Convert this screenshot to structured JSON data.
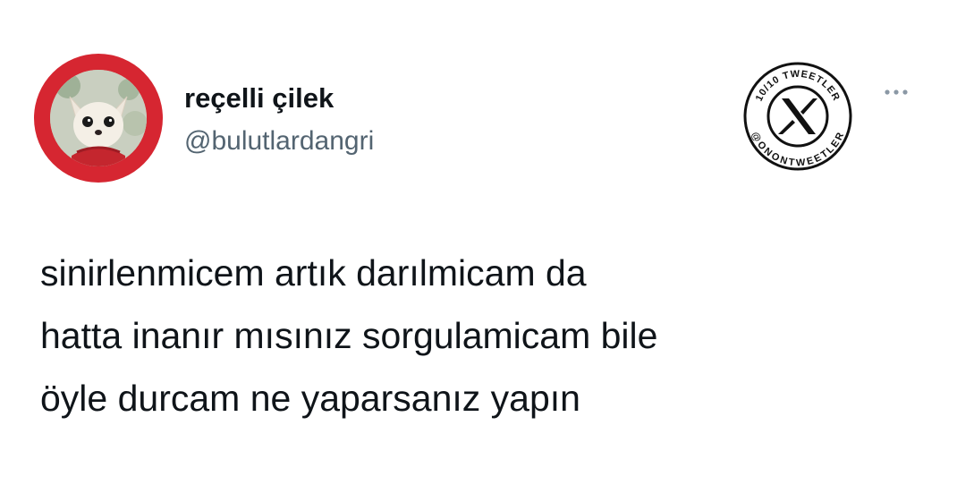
{
  "tweet": {
    "author": {
      "display_name": "reçelli çilek",
      "handle": "@bulutlardangri",
      "avatar_icon": "dog-avatar-icon",
      "avatar_ring_color": "#d62631"
    },
    "text_lines": [
      "sinirlenmicem artık darılmicam da",
      "hatta inanır mısınız sorgulamicam bile",
      "öyle durcam ne yaparsanız yapın"
    ],
    "more_icon": "more-dots-icon"
  },
  "watermark": {
    "top_text": "10/10 TWEETLER",
    "bottom_text": "@ONONTWEETLER",
    "icon": "x-logo-icon"
  },
  "colors": {
    "text": "#0f1419",
    "secondary_text": "#536471"
  }
}
